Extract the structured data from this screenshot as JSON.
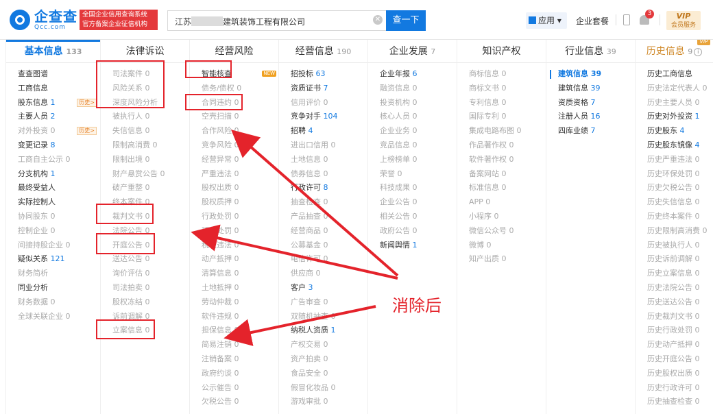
{
  "header": {
    "logo_cn": "企查查",
    "logo_en": "Qcc.com",
    "slogan_line1": "全国企业信用查询系统",
    "slogan_line2": "官方备案企业征信机构",
    "search_prefix": "江苏",
    "search_suffix": "建筑装饰工程有限公司",
    "clear_icon": "close-icon",
    "search_button": "查一下",
    "apps_label": "应用",
    "package_label": "企业套餐",
    "notification_count": "3",
    "vip_label": "VIP",
    "vip_sub": "会员服务"
  },
  "columns": [
    {
      "title": "基本信息",
      "count": "133",
      "state": "active",
      "items": [
        {
          "label": "查查图谱"
        },
        {
          "label": "工商信息"
        },
        {
          "label": "股东信息",
          "n": "1",
          "tag": "历史>"
        },
        {
          "label": "主要人员",
          "n": "2"
        },
        {
          "label": "对外投资",
          "n": "0",
          "dim": true,
          "tag": "历史>"
        },
        {
          "label": "变更记录",
          "n": "8"
        },
        {
          "label": "工商自主公示",
          "n": "0",
          "dim": true
        },
        {
          "label": "分支机构",
          "n": "1"
        },
        {
          "label": "最终受益人"
        },
        {
          "label": "实际控制人"
        },
        {
          "label": "协同股东",
          "n": "0",
          "dim": true
        },
        {
          "label": "控制企业",
          "n": "0",
          "dim": true
        },
        {
          "label": "间接持股企业",
          "n": "0",
          "dim": true
        },
        {
          "label": "疑似关系",
          "n": "121"
        },
        {
          "label": "财务简析",
          "dim": true
        },
        {
          "label": "同业分析"
        },
        {
          "label": "财务数据",
          "n": "0",
          "dim": true
        },
        {
          "label": "全球关联企业",
          "n": "0",
          "dim": true
        }
      ]
    },
    {
      "title": "法律诉讼",
      "count": "",
      "state": "",
      "items": [
        {
          "label": "司法案件",
          "n": "0",
          "dim": true
        },
        {
          "label": "风险关系",
          "n": "0",
          "dim": true
        },
        {
          "label": "深度风险分析",
          "dim": true
        },
        {
          "label": "被执行人",
          "n": "0",
          "dim": true
        },
        {
          "label": "失信信息",
          "n": "0",
          "dim": true
        },
        {
          "label": "限制高消费",
          "n": "0",
          "dim": true
        },
        {
          "label": "限制出境",
          "n": "0",
          "dim": true
        },
        {
          "label": "财产悬赏公告",
          "n": "0",
          "dim": true
        },
        {
          "label": "破产重整",
          "n": "0",
          "dim": true
        },
        {
          "label": "终本案件",
          "n": "0",
          "dim": true
        },
        {
          "label": "裁判文书",
          "n": "0",
          "dim": true
        },
        {
          "label": "法院公告",
          "n": "0",
          "dim": true
        },
        {
          "label": "开庭公告",
          "n": "0",
          "dim": true
        },
        {
          "label": "送达公告",
          "n": "0",
          "dim": true
        },
        {
          "label": "询价评估",
          "n": "0",
          "dim": true
        },
        {
          "label": "司法拍卖",
          "n": "0",
          "dim": true
        },
        {
          "label": "股权冻结",
          "n": "0",
          "dim": true
        },
        {
          "label": "诉前调解",
          "n": "0",
          "dim": true
        },
        {
          "label": "立案信息",
          "n": "0",
          "dim": true
        }
      ]
    },
    {
      "title": "经营风险",
      "count": "",
      "state": "",
      "items": [
        {
          "label": "智能核查",
          "tag_new": "NEW"
        },
        {
          "label": "债务/债权",
          "n": "0",
          "dim": true
        },
        {
          "label": "合同违约",
          "n": "0",
          "dim": true
        },
        {
          "label": "空壳扫描",
          "n": "0",
          "dim": true
        },
        {
          "label": "合作风险",
          "n": "0",
          "dim": true
        },
        {
          "label": "竞争风险",
          "n": "0",
          "dim": true
        },
        {
          "label": "经营异常",
          "n": "0",
          "dim": true
        },
        {
          "label": "严重违法",
          "n": "0",
          "dim": true
        },
        {
          "label": "股权出质",
          "n": "0",
          "dim": true
        },
        {
          "label": "股权质押",
          "n": "0",
          "dim": true
        },
        {
          "label": "行政处罚",
          "n": "0",
          "dim": true
        },
        {
          "label": "环保处罚",
          "n": "0",
          "dim": true
        },
        {
          "label": "税收违法",
          "n": "0",
          "dim": true
        },
        {
          "label": "动产抵押",
          "n": "0",
          "dim": true
        },
        {
          "label": "清算信息",
          "n": "0",
          "dim": true
        },
        {
          "label": "土地抵押",
          "n": "0",
          "dim": true
        },
        {
          "label": "劳动仲裁",
          "n": "0",
          "dim": true
        },
        {
          "label": "软件违规",
          "n": "0",
          "dim": true
        },
        {
          "label": "担保信息",
          "n": "0",
          "dim": true
        },
        {
          "label": "简易注销",
          "n": "0",
          "dim": true
        },
        {
          "label": "注销备案",
          "n": "0",
          "dim": true
        },
        {
          "label": "政府约谈",
          "n": "0",
          "dim": true
        },
        {
          "label": "公示催告",
          "n": "0",
          "dim": true
        },
        {
          "label": "欠税公告",
          "n": "0",
          "dim": true
        }
      ]
    },
    {
      "title": "经营信息",
      "count": "190",
      "state": "",
      "items": [
        {
          "label": "招投标",
          "n": "63"
        },
        {
          "label": "资质证书",
          "n": "7"
        },
        {
          "label": "信用评价",
          "n": "0",
          "dim": true
        },
        {
          "label": "竞争对手",
          "n": "104"
        },
        {
          "label": "招聘",
          "n": "4"
        },
        {
          "label": "进出口信用",
          "n": "0",
          "dim": true
        },
        {
          "label": "土地信息",
          "n": "0",
          "dim": true
        },
        {
          "label": "债券信息",
          "n": "0",
          "dim": true
        },
        {
          "label": "行政许可",
          "n": "8"
        },
        {
          "label": "抽查检查",
          "n": "0",
          "dim": true
        },
        {
          "label": "产品抽查",
          "n": "0",
          "dim": true
        },
        {
          "label": "经营商品",
          "n": "0",
          "dim": true
        },
        {
          "label": "公募基金",
          "n": "0",
          "dim": true
        },
        {
          "label": "电信许可",
          "n": "0",
          "dim": true
        },
        {
          "label": "供应商",
          "n": "0",
          "dim": true
        },
        {
          "label": "客户",
          "n": "3"
        },
        {
          "label": "广告审查",
          "n": "0",
          "dim": true
        },
        {
          "label": "双随机抽查",
          "n": "0",
          "dim": true
        },
        {
          "label": "纳税人资质",
          "n": "1"
        },
        {
          "label": "产权交易",
          "n": "0",
          "dim": true
        },
        {
          "label": "资产拍卖",
          "n": "0",
          "dim": true
        },
        {
          "label": "食品安全",
          "n": "0",
          "dim": true
        },
        {
          "label": "假冒化妆品",
          "n": "0",
          "dim": true
        },
        {
          "label": "游戏审批",
          "n": "0",
          "dim": true
        }
      ]
    },
    {
      "title": "企业发展",
      "count": "7",
      "state": "",
      "items": [
        {
          "label": "企业年报",
          "n": "6"
        },
        {
          "label": "融资信息",
          "n": "0",
          "dim": true
        },
        {
          "label": "投资机构",
          "n": "0",
          "dim": true
        },
        {
          "label": "核心人员",
          "n": "0",
          "dim": true
        },
        {
          "label": "企业业务",
          "n": "0",
          "dim": true
        },
        {
          "label": "竞品信息",
          "n": "0",
          "dim": true
        },
        {
          "label": "上榜榜单",
          "n": "0",
          "dim": true
        },
        {
          "label": "荣誉",
          "n": "0",
          "dim": true
        },
        {
          "label": "科技成果",
          "n": "0",
          "dim": true
        },
        {
          "label": "企业公告",
          "n": "0",
          "dim": true
        },
        {
          "label": "相关公告",
          "n": "0",
          "dim": true
        },
        {
          "label": "政府公告",
          "n": "0",
          "dim": true
        },
        {
          "label": "新闻舆情",
          "n": "1"
        }
      ]
    },
    {
      "title": "知识产权",
      "count": "",
      "state": "",
      "items": [
        {
          "label": "商标信息",
          "n": "0",
          "dim": true
        },
        {
          "label": "商标文书",
          "n": "0",
          "dim": true
        },
        {
          "label": "专利信息",
          "n": "0",
          "dim": true
        },
        {
          "label": "国际专利",
          "n": "0",
          "dim": true
        },
        {
          "label": "集成电路布图",
          "n": "0",
          "dim": true
        },
        {
          "label": "作品著作权",
          "n": "0",
          "dim": true
        },
        {
          "label": "软件著作权",
          "n": "0",
          "dim": true
        },
        {
          "label": "备案网站",
          "n": "0",
          "dim": true
        },
        {
          "label": "标准信息",
          "n": "0",
          "dim": true
        },
        {
          "label": "APP",
          "n": "0",
          "dim": true
        },
        {
          "label": "小程序",
          "n": "0",
          "dim": true
        },
        {
          "label": "微信公众号",
          "n": "0",
          "dim": true
        },
        {
          "label": "微博",
          "n": "0",
          "dim": true
        },
        {
          "label": "知产出质",
          "n": "0",
          "dim": true
        }
      ]
    },
    {
      "title": "行业信息",
      "count": "39",
      "state": "",
      "items": [
        {
          "label": "建筑信息",
          "n": "39",
          "sel": true
        },
        {
          "label": "建筑信息",
          "n": "39"
        },
        {
          "label": "资质资格",
          "n": "7"
        },
        {
          "label": "注册人员",
          "n": "16"
        },
        {
          "label": "四库业绩",
          "n": "7"
        }
      ]
    },
    {
      "title": "历史信息",
      "count": "9",
      "state": "history",
      "vip": "VIP",
      "items": [
        {
          "label": "历史工商信息"
        },
        {
          "label": "历史法定代表人",
          "n": "0",
          "dim": true
        },
        {
          "label": "历史主要人员",
          "n": "0",
          "dim": true
        },
        {
          "label": "历史对外投资",
          "n": "1"
        },
        {
          "label": "历史股东",
          "n": "4"
        },
        {
          "label": "历史股东镜像",
          "n": "4"
        },
        {
          "label": "历史严重违法",
          "n": "0",
          "dim": true
        },
        {
          "label": "历史环保处罚",
          "n": "0",
          "dim": true
        },
        {
          "label": "历史欠税公告",
          "n": "0",
          "dim": true
        },
        {
          "label": "历史失信信息",
          "n": "0",
          "dim": true
        },
        {
          "label": "历史终本案件",
          "n": "0",
          "dim": true
        },
        {
          "label": "历史限制高消费",
          "n": "0",
          "dim": true
        },
        {
          "label": "历史被执行人",
          "n": "0",
          "dim": true
        },
        {
          "label": "历史诉前调解",
          "n": "0",
          "dim": true
        },
        {
          "label": "历史立案信息",
          "n": "0",
          "dim": true
        },
        {
          "label": "历史法院公告",
          "n": "0",
          "dim": true
        },
        {
          "label": "历史送达公告",
          "n": "0",
          "dim": true
        },
        {
          "label": "历史裁判文书",
          "n": "0",
          "dim": true
        },
        {
          "label": "历史行政处罚",
          "n": "0",
          "dim": true
        },
        {
          "label": "历史动产抵押",
          "n": "0",
          "dim": true
        },
        {
          "label": "历史开庭公告",
          "n": "0",
          "dim": true
        },
        {
          "label": "历史股权出质",
          "n": "0",
          "dim": true
        },
        {
          "label": "历史行政许可",
          "n": "0",
          "dim": true
        },
        {
          "label": "历史抽查检查",
          "n": "0",
          "dim": true
        }
      ]
    }
  ],
  "annotation": {
    "text": "消除后",
    "color": "#e4232b"
  },
  "colors": {
    "brand": "#1279e0",
    "highlight_red": "#e4232b",
    "history_orange": "#d08a2b"
  }
}
